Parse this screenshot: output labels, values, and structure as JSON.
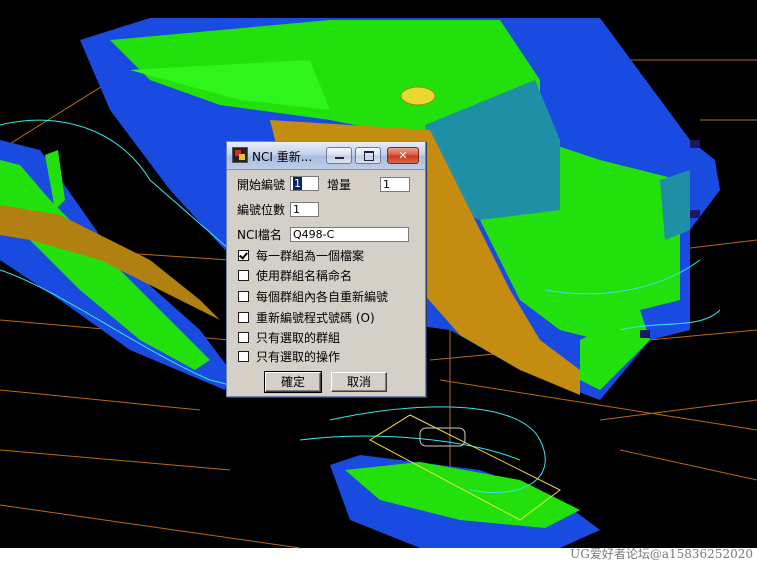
{
  "watermark": "UG爱好者论坛@a15836252020",
  "dialog": {
    "title": "NCI 重新...",
    "start_number_label": "開始編號",
    "start_number_value": "1",
    "increment_label": "增量",
    "increment_value": "1",
    "digits_label": "編號位數",
    "digits_value": "1",
    "nci_filename_label": "NCI檔名",
    "nci_filename_value": "Q498-C",
    "options": [
      {
        "label": "每一群組為一個檔案",
        "checked": true
      },
      {
        "label": "使用群組名稱命名",
        "checked": false
      },
      {
        "label": "每個群組內各自重新編號",
        "checked": false
      },
      {
        "label": "重新編號程式號碼 (O)",
        "checked": false
      },
      {
        "label": "只有選取的群組",
        "checked": false
      },
      {
        "label": "只有選取的操作",
        "checked": false
      }
    ],
    "ok_label": "確定",
    "cancel_label": "取消"
  },
  "colors": {
    "background": "#000000",
    "part_green": "#22e00c",
    "part_blue": "#1a4be0",
    "part_orange": "#c48c10",
    "toolpath_cyan": "#38e6e6"
  }
}
